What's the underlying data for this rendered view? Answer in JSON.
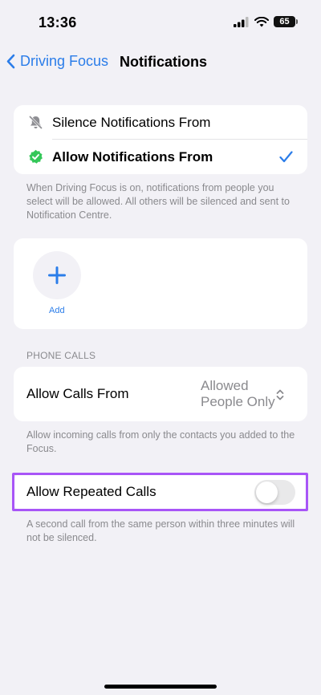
{
  "status_bar": {
    "time": "13:36",
    "battery": "65"
  },
  "nav": {
    "back_label": "Driving Focus",
    "title": "Notifications"
  },
  "notifications_mode": {
    "silence_label": "Silence Notifications From",
    "allow_label": "Allow Notifications From",
    "footer": "When Driving Focus is on, notifications from people you select will be allowed. All others will be silenced and sent to Notification Centre."
  },
  "people": {
    "add_label": "Add"
  },
  "phone_calls": {
    "header": "PHONE CALLS",
    "allow_calls_label": "Allow Calls From",
    "allow_calls_value_line1": "Allowed",
    "allow_calls_value_line2": "People Only",
    "footer": "Allow incoming calls from only the contacts you added to the Focus."
  },
  "repeated_calls": {
    "label": "Allow Repeated Calls",
    "enabled": false,
    "footer": "A second call from the same person within three minutes will not be silenced."
  },
  "colors": {
    "accent": "#2b7de9",
    "check_badge": "#34c759",
    "highlight": "#a855f7"
  }
}
